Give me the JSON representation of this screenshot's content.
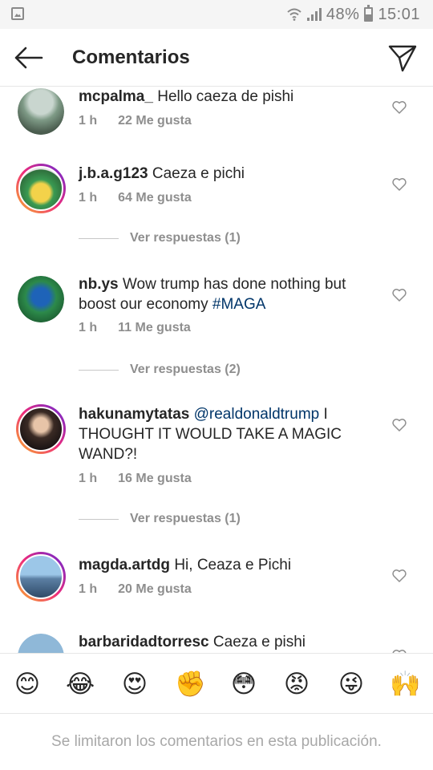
{
  "status_bar": {
    "battery_text": "48%",
    "time": "15:01",
    "icons": [
      "image-icon",
      "wifi-icon",
      "signal-icon",
      "battery-icon"
    ]
  },
  "header": {
    "title": "Comentarios",
    "back_icon": "back-arrow-icon",
    "send_icon": "direct-send-icon"
  },
  "comments": [
    {
      "username": "mcpalma_",
      "text": "Hello caeza de pishi",
      "mention": "",
      "hashtag": "",
      "time": "1 h",
      "likes": "22 Me gusta",
      "replies": ""
    },
    {
      "username": "j.b.a.g123",
      "text": "Caeza e pichi",
      "mention": "",
      "hashtag": "",
      "time": "1 h",
      "likes": "64 Me gusta",
      "replies": "Ver respuestas (1)"
    },
    {
      "username": "nb.ys",
      "text": "Wow trump has done nothing but boost our economy ",
      "mention": "",
      "hashtag": "#MAGA",
      "time": "1 h",
      "likes": "11 Me gusta",
      "replies": "Ver respuestas (2)"
    },
    {
      "username": "hakunamytatas",
      "text": " I THOUGHT IT WOULD TAKE A MAGIC WAND?!",
      "mention": "@realdonaldtrump",
      "hashtag": "",
      "time": "1 h",
      "likes": "16 Me gusta",
      "replies": "Ver respuestas (1)"
    },
    {
      "username": "magda.artdg",
      "text": "Hi, Ceaza e Pichi",
      "mention": "",
      "hashtag": "",
      "time": "1 h",
      "likes": "20 Me gusta",
      "replies": ""
    },
    {
      "username": "barbaridadtorresc",
      "text": "Caeza e pishi",
      "mention": "",
      "hashtag": "",
      "time": "",
      "likes": "",
      "replies": ""
    }
  ],
  "emoji_bar": [
    "😊",
    "😂",
    "😍",
    "✊",
    "😳",
    "😡",
    "😜",
    "🙌"
  ],
  "footer": {
    "notice": "Se limitaron los comentarios en esta publicación."
  }
}
